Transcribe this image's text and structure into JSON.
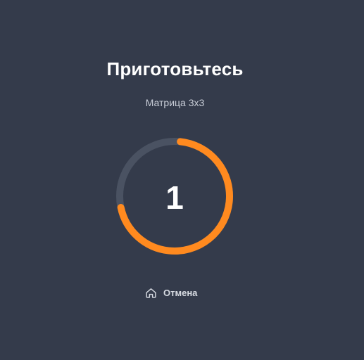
{
  "countdown_screen": {
    "title": "Приготовьтесь",
    "subtitle": "Матрица 3x3",
    "count": "1",
    "progress_fraction": 0.7,
    "cancel_label": "Отмена",
    "icons": {
      "cancel": "home-icon"
    },
    "colors": {
      "background": "#343b4b",
      "ring_track": "#4a5262",
      "ring_progress": "#ff8a1f",
      "text_primary": "#ffffff",
      "text_secondary": "#c9ced8"
    }
  }
}
